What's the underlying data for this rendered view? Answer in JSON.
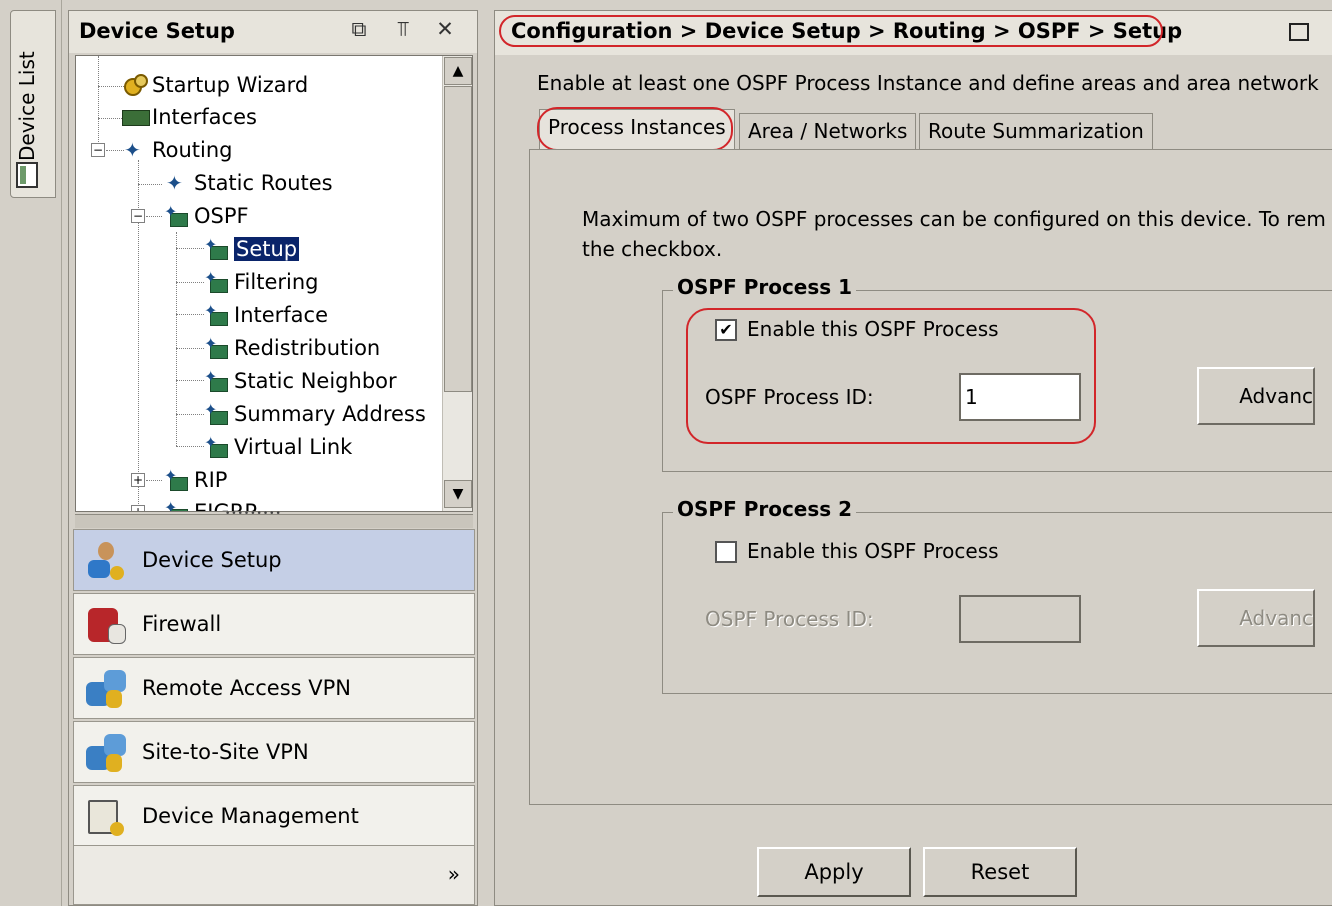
{
  "device_list": {
    "tab_label": "Device List"
  },
  "left_panel": {
    "title": "Device Setup",
    "header_buttons": [
      "⧉",
      "↕",
      "×"
    ],
    "tree": [
      {
        "label": "Startup Wizard",
        "icon": "wizard-icon"
      },
      {
        "label": "Interfaces",
        "icon": "interfaces-icon"
      },
      {
        "label": "Routing",
        "icon": "routing-icon"
      },
      {
        "label": "Static Routes",
        "icon": "routing-icon"
      },
      {
        "label": "OSPF",
        "icon": "ospf-icon"
      },
      {
        "label": "Setup",
        "icon": "ospf-icon",
        "selected": true
      },
      {
        "label": "Filtering",
        "icon": "ospf-icon"
      },
      {
        "label": "Interface",
        "icon": "ospf-icon"
      },
      {
        "label": "Redistribution",
        "icon": "ospf-icon"
      },
      {
        "label": "Static Neighbor",
        "icon": "ospf-icon"
      },
      {
        "label": "Summary Address",
        "icon": "ospf-icon"
      },
      {
        "label": "Virtual Link",
        "icon": "ospf-icon"
      },
      {
        "label": "RIP",
        "icon": "ospf-icon"
      },
      {
        "label": "EIGRP",
        "icon": "ospf-icon"
      }
    ],
    "nav": [
      {
        "label": "Device Setup",
        "active": true
      },
      {
        "label": "Firewall"
      },
      {
        "label": "Remote Access VPN"
      },
      {
        "label": "Site-to-Site VPN"
      },
      {
        "label": "Device Management"
      }
    ],
    "more_label": "»"
  },
  "right_panel": {
    "breadcrumb": "Configuration > Device Setup > Routing > OSPF > Setup",
    "intro": "Enable at least one OSPF Process Instance and define areas and area network",
    "tabs": [
      "Process Instances",
      "Area / Networks",
      "Route Summarization"
    ],
    "max_text_line1": "Maximum of two OSPF processes can be configured on this device. To rem",
    "max_text_line2": "the checkbox.",
    "process1": {
      "title": "OSPF Process 1",
      "enable_label": "Enable this OSPF Process",
      "enabled": true,
      "id_label": "OSPF Process ID:",
      "id_value": "1",
      "advanced_label": "Advanc"
    },
    "process2": {
      "title": "OSPF Process 2",
      "enable_label": "Enable this OSPF Process",
      "enabled": false,
      "id_label": "OSPF Process ID:",
      "id_value": "",
      "advanced_label": "Advanc"
    },
    "apply_label": "Apply",
    "reset_label": "Reset"
  },
  "colors": {
    "highlight_red": "#d2262a",
    "selection_blue": "#0a246a",
    "active_nav": "#c5cfe6"
  }
}
